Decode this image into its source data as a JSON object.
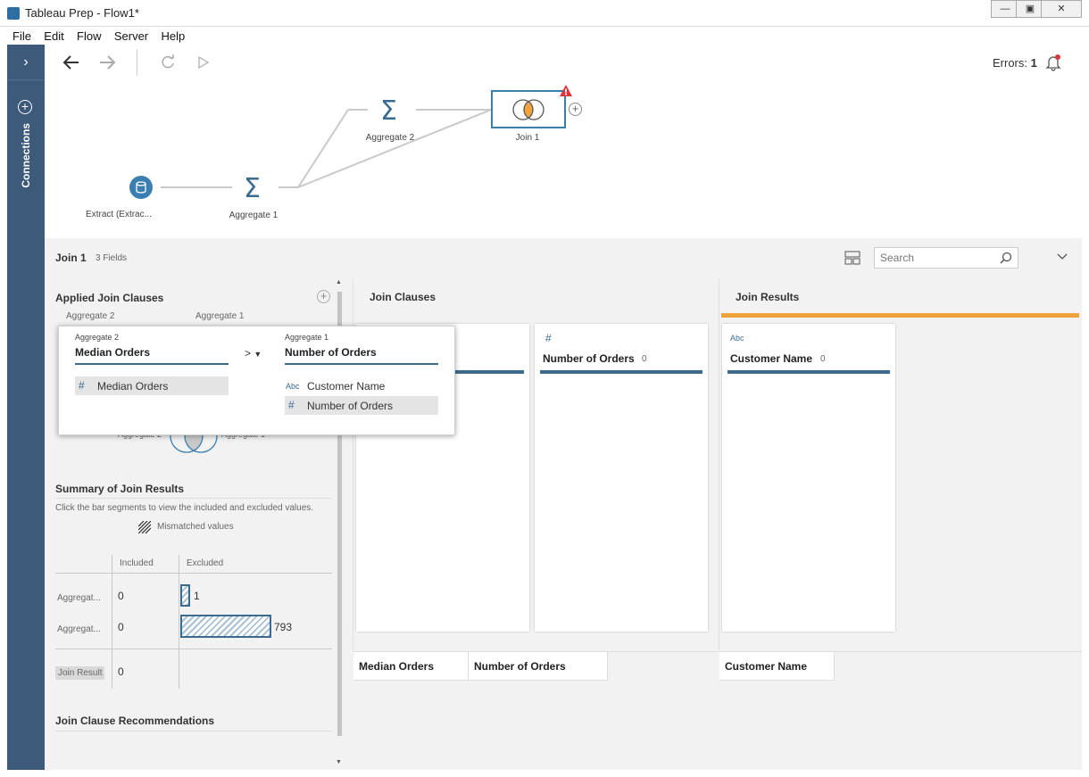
{
  "window": {
    "title": "Tableau Prep - Flow1*"
  },
  "menu": [
    "File",
    "Edit",
    "Flow",
    "Server",
    "Help"
  ],
  "sidebar": {
    "toggle": "›",
    "label": "Connections"
  },
  "toolbar": {
    "errors_label": "Errors:",
    "errors_count": "1"
  },
  "flow": {
    "nodes": [
      {
        "id": "extract",
        "label": "Extract (Extrac..."
      },
      {
        "id": "agg1",
        "label": "Aggregate 1"
      },
      {
        "id": "agg2",
        "label": "Aggregate 2"
      },
      {
        "id": "join1",
        "label": "Join 1"
      }
    ]
  },
  "profile": {
    "title": "Join 1",
    "fields_count": "3 Fields",
    "search_placeholder": "Search"
  },
  "left_panel": {
    "applied_title": "Applied Join Clauses",
    "left_table": "Aggregate 2",
    "right_table": "Aggregate 1",
    "venn_left": "Aggregate 2",
    "venn_right": "Aggregate 1",
    "summary_title": "Summary of Join Results",
    "summary_hint": "Click the bar segments to view the included and excluded values.",
    "mismatched_label": "Mismatched values",
    "table_headers": {
      "included": "Included",
      "excluded": "Excluded"
    },
    "rows": [
      {
        "label": "Aggregat...",
        "included": "0",
        "excluded": "1"
      },
      {
        "label": "Aggregat...",
        "included": "0",
        "excluded": "793"
      }
    ],
    "join_result": {
      "label": "Join Result",
      "value": "0"
    },
    "recommendations_title": "Join Clause Recommendations"
  },
  "popup": {
    "left_source": "Aggregate 2",
    "left_field": "Median Orders",
    "operator": ">",
    "right_source": "Aggregate 1",
    "right_field": "Number of Orders",
    "left_options": [
      {
        "type": "#",
        "name": "Median Orders"
      }
    ],
    "right_options": [
      {
        "type": "Abc",
        "name": "Customer Name"
      },
      {
        "type": "#",
        "name": "Number of Orders"
      }
    ]
  },
  "join_clauses": {
    "title": "Join Clauses",
    "cards": [
      {
        "type": "#",
        "name": "Number of Orders",
        "count": "0"
      }
    ]
  },
  "join_results": {
    "title": "Join Results",
    "accent": "#f1a33d",
    "cards": [
      {
        "type": "Abc",
        "name": "Customer Name",
        "count": "0"
      }
    ]
  },
  "grid": {
    "columns_left": [
      "Median Orders",
      "Number of Orders"
    ],
    "columns_right": [
      "Customer Name"
    ]
  },
  "colors": {
    "brand_blue": "#3b6a91",
    "sidebar": "#3d5a7a",
    "error_red": "#e0323b"
  }
}
